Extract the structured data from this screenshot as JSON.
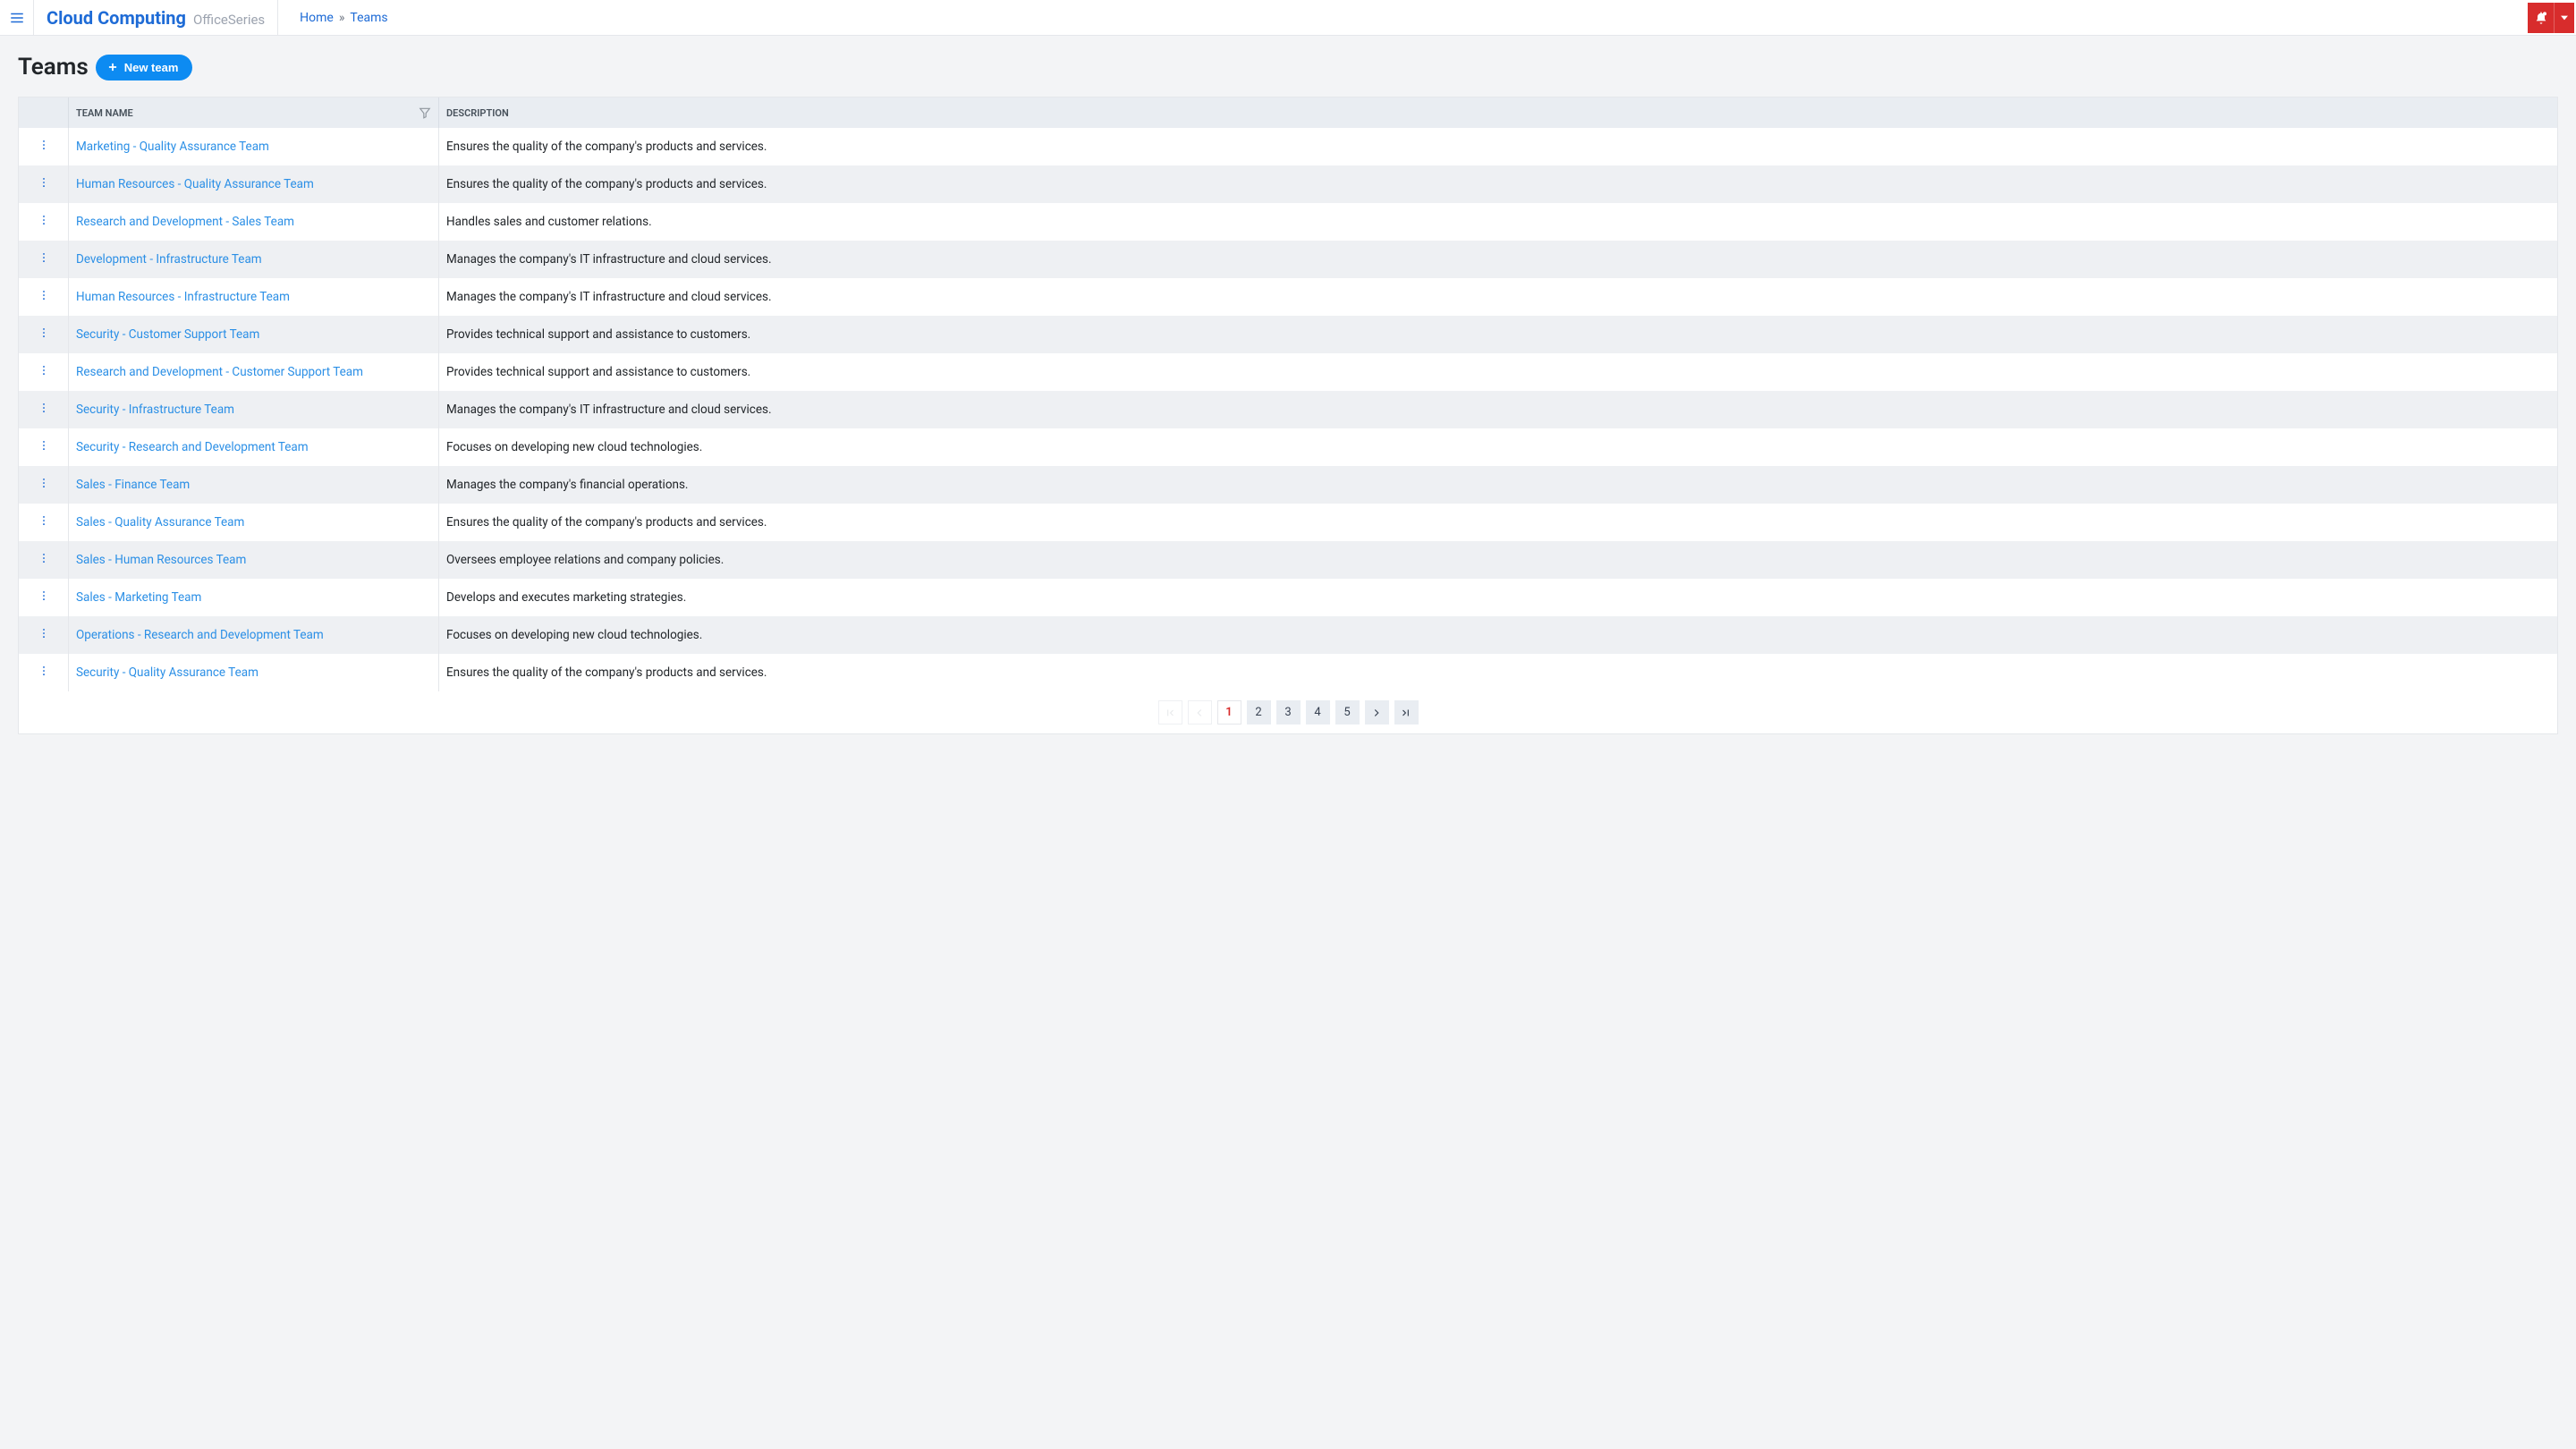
{
  "brand": {
    "title": "Cloud Computing",
    "subtitle": "OfficeSeries"
  },
  "breadcrumb": {
    "home": "Home",
    "sep": "»",
    "current": "Teams"
  },
  "page": {
    "title": "Teams",
    "new_button": "New team"
  },
  "table": {
    "headers": {
      "name": "Team Name",
      "description": "Description"
    },
    "rows": [
      {
        "name": "Marketing - Quality Assurance Team",
        "description": "Ensures the quality of the company's products and services."
      },
      {
        "name": "Human Resources - Quality Assurance Team",
        "description": "Ensures the quality of the company's products and services."
      },
      {
        "name": "Research and Development - Sales Team",
        "description": "Handles sales and customer relations."
      },
      {
        "name": "Development - Infrastructure Team",
        "description": "Manages the company's IT infrastructure and cloud services."
      },
      {
        "name": "Human Resources - Infrastructure Team",
        "description": "Manages the company's IT infrastructure and cloud services."
      },
      {
        "name": "Security - Customer Support Team",
        "description": "Provides technical support and assistance to customers."
      },
      {
        "name": "Research and Development - Customer Support Team",
        "description": "Provides technical support and assistance to customers."
      },
      {
        "name": "Security - Infrastructure Team",
        "description": "Manages the company's IT infrastructure and cloud services."
      },
      {
        "name": "Security - Research and Development Team",
        "description": "Focuses on developing new cloud technologies."
      },
      {
        "name": "Sales - Finance Team",
        "description": "Manages the company's financial operations."
      },
      {
        "name": "Sales - Quality Assurance Team",
        "description": "Ensures the quality of the company's products and services."
      },
      {
        "name": "Sales - Human Resources Team",
        "description": "Oversees employee relations and company policies."
      },
      {
        "name": "Sales - Marketing Team",
        "description": "Develops and executes marketing strategies."
      },
      {
        "name": "Operations - Research and Development Team",
        "description": "Focuses on developing new cloud technologies."
      },
      {
        "name": "Security - Quality Assurance Team",
        "description": "Ensures the quality of the company's products and services."
      }
    ]
  },
  "pagination": {
    "pages": [
      "1",
      "2",
      "3",
      "4",
      "5"
    ],
    "active": "1"
  }
}
